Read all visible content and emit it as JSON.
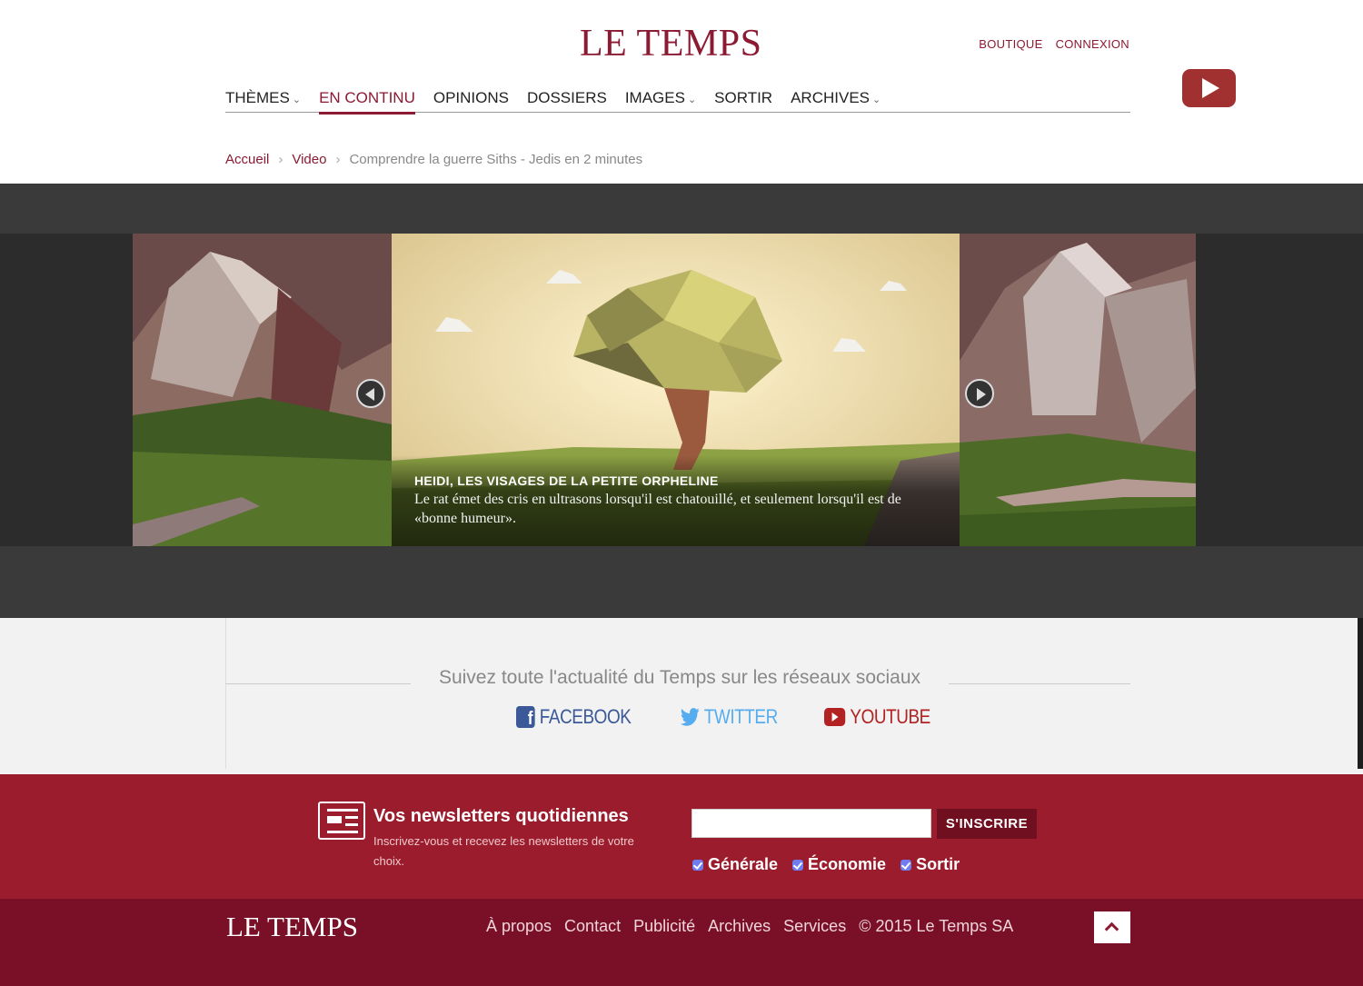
{
  "header": {
    "logo": "LE TEMPS",
    "top_links": [
      "BOUTIQUE",
      "CONNEXION"
    ],
    "youtube_button": "play-icon"
  },
  "nav": {
    "items": [
      {
        "label": "THÈMES",
        "dropdown": true
      },
      {
        "label": "EN CONTINU",
        "active": true
      },
      {
        "label": "OPINIONS"
      },
      {
        "label": "DOSSIERS"
      },
      {
        "label": "IMAGES",
        "dropdown": true
      },
      {
        "label": "SORTIR"
      },
      {
        "label": "ARCHIVES",
        "dropdown": true
      }
    ],
    "dropdown_glyph": "⌄"
  },
  "breadcrumb": {
    "items": [
      "Accueil",
      "Video"
    ],
    "separator": "›",
    "current": "Comprendre la guerre Siths - Jedis en 2 minutes"
  },
  "slider": {
    "caption_title": "HEIDI, LES VISAGES DE LA PETITE ORPHELINE",
    "caption_text": "Le rat émet des cris en ultrasons lorsqu'il est chatouillé, et seulement lorsqu'il est de «bonne humeur»."
  },
  "social": {
    "title": "Suivez toute l'actualité du Temps sur les réseaux sociaux",
    "links": [
      {
        "label": "FACEBOOK",
        "icon": "facebook-icon"
      },
      {
        "label": "TWITTER",
        "icon": "twitter-icon"
      },
      {
        "label": "YOUTUBE",
        "icon": "youtube-icon"
      }
    ]
  },
  "newsletter": {
    "title": "Vos newsletters quotidiennes",
    "subtitle": "Inscrivez-vous et recevez les newsletters de votre choix.",
    "email_value": "",
    "button": "S'INSCRIRE",
    "options": [
      "Générale",
      "Économie",
      "Sortir"
    ]
  },
  "footer": {
    "logo": "LE TEMPS",
    "links": [
      "À propos",
      "Contact",
      "Publicité",
      "Archives",
      "Services",
      "© 2015 Le Temps SA"
    ],
    "back_to_top": "chevron-up-icon"
  },
  "colors": {
    "brand": "#8b1a32",
    "newsletter_bg": "#9b1c2c",
    "footer_bg": "#7a1028"
  }
}
